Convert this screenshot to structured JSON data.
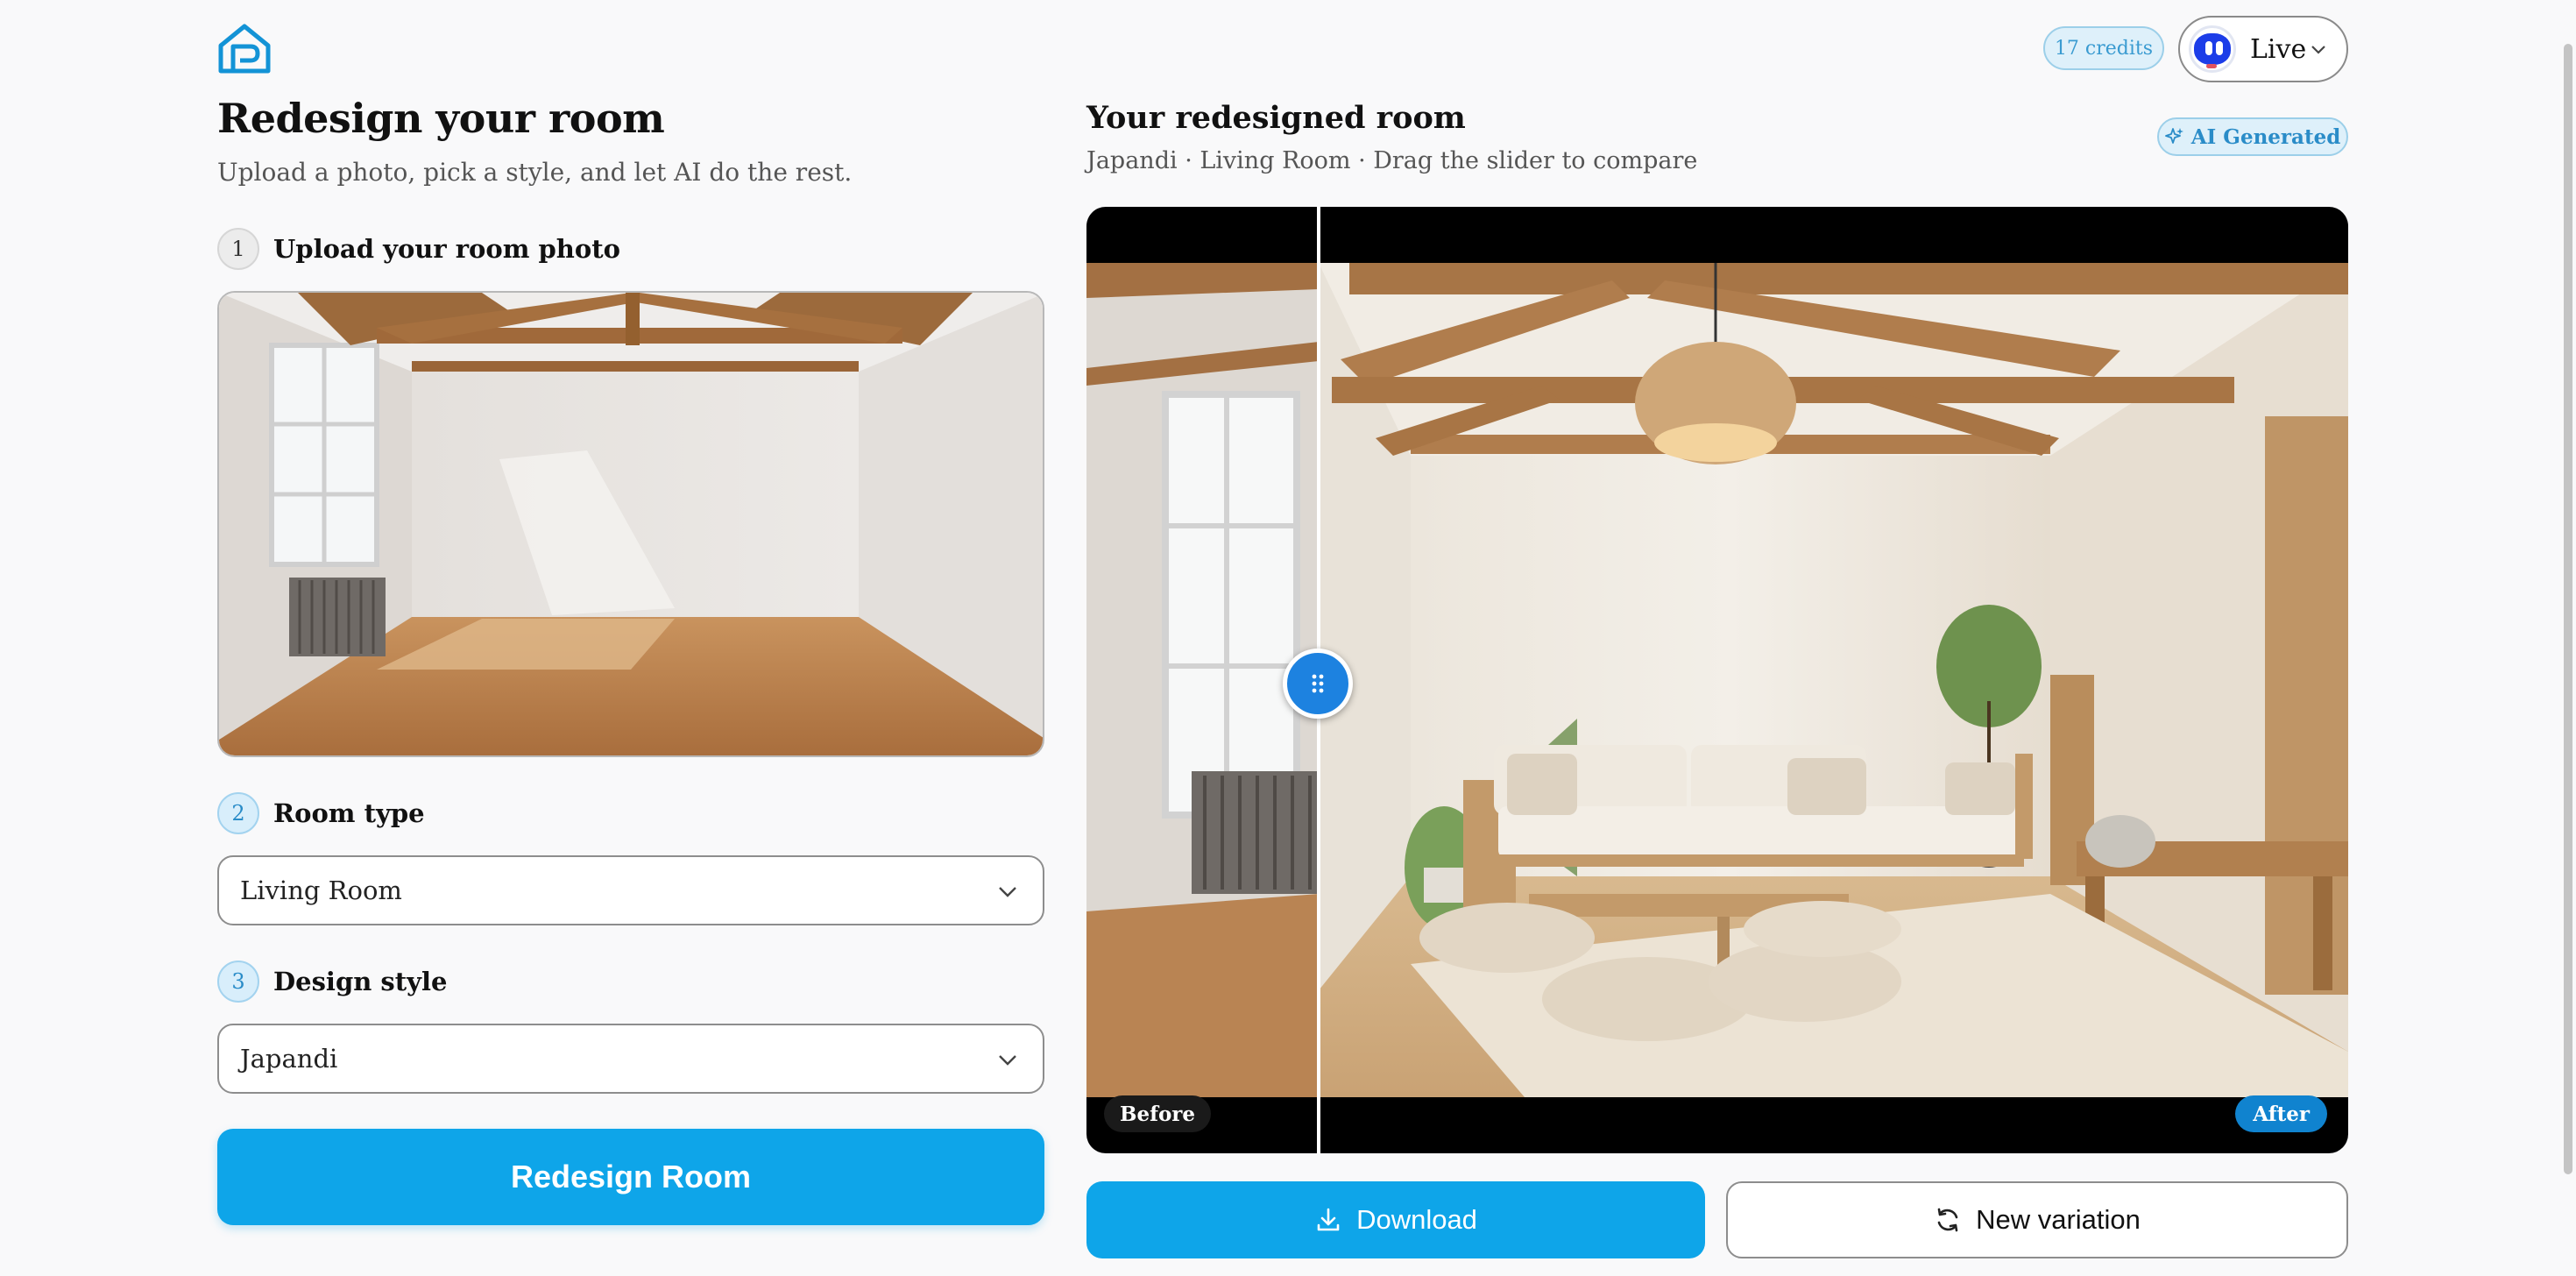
{
  "header": {
    "credits": "17 credits",
    "user": {
      "name": "Live"
    }
  },
  "left": {
    "title": "Redesign your room",
    "subtitle": "Upload a photo, pick a style, and let AI do the rest.",
    "steps": [
      {
        "number": "1",
        "label": "Upload your room photo"
      },
      {
        "number": "2",
        "label": "Room type"
      },
      {
        "number": "3",
        "label": "Design style"
      }
    ],
    "room_type": {
      "selected": "Living Room"
    },
    "design_style": {
      "selected": "Japandi"
    },
    "submit_label": "Redesign Room"
  },
  "right": {
    "title": "Your redesigned room",
    "subtitle": "Japandi · Living Room · Drag the slider to compare",
    "badge": "AI Generated",
    "compare": {
      "before_label": "Before",
      "after_label": "After",
      "slider_position": 0.18
    },
    "download_label": "Download",
    "variation_label": "New variation"
  },
  "colors": {
    "accent": "#0ea5e9",
    "accent_light": "#def0fa",
    "handle": "#1d82e0"
  }
}
